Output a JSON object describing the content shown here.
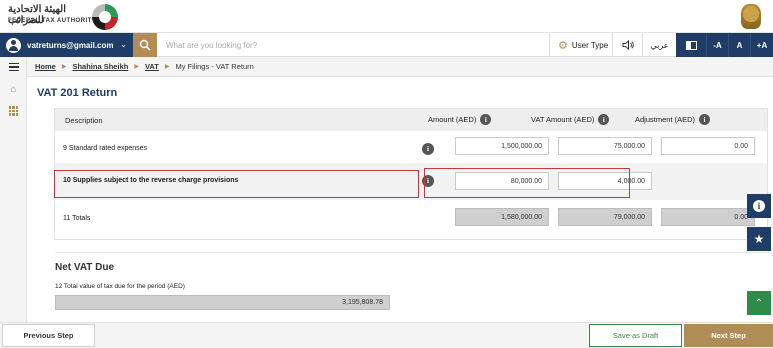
{
  "header": {
    "logo_arabic": "الهيئة الاتحادية للضرائب",
    "logo_english": "FEDERAL TAX AUTHORITY"
  },
  "navbar": {
    "account_email": "vatreturns@gmail.com",
    "search_placeholder": "What are you looking for?",
    "user_type_label": "User Type",
    "arabic_label": "عربي",
    "font_small": "-A",
    "font_normal": "A",
    "font_large": "+A"
  },
  "breadcrumb": {
    "items": [
      "Home",
      "Shahina Sheikh",
      "VAT"
    ],
    "current": "My Filings - VAT Return"
  },
  "page": {
    "title": "VAT 201 Return"
  },
  "table": {
    "headers": {
      "description": "Description",
      "amount": "Amount (AED)",
      "vat_amount": "VAT Amount (AED)",
      "adjustment": "Adjustment (AED)"
    },
    "rows": [
      {
        "label": "9 Standard rated expenses",
        "amount": "1,500,000.00",
        "vat": "75,000.00",
        "adjustment": "0.00"
      },
      {
        "label": "10 Supplies subject to the reverse charge provisions",
        "amount": "80,000.00",
        "vat": "4,000.00"
      },
      {
        "label": "11 Totals",
        "amount": "1,580,000.00",
        "vat": "79,000.00",
        "adjustment": "0.00"
      }
    ]
  },
  "net_vat": {
    "title": "Net VAT Due",
    "label": "12 Total value of tax due for the period (AED)",
    "value": "3,195,808.78"
  },
  "footer": {
    "prev": "Previous Step",
    "draft": "Save as Draft",
    "next": "Next Step"
  },
  "colors": {
    "navy": "#1f3d66",
    "gold": "#b08d57",
    "green": "#2e8b4a",
    "highlight_red": "#c23a3a"
  }
}
